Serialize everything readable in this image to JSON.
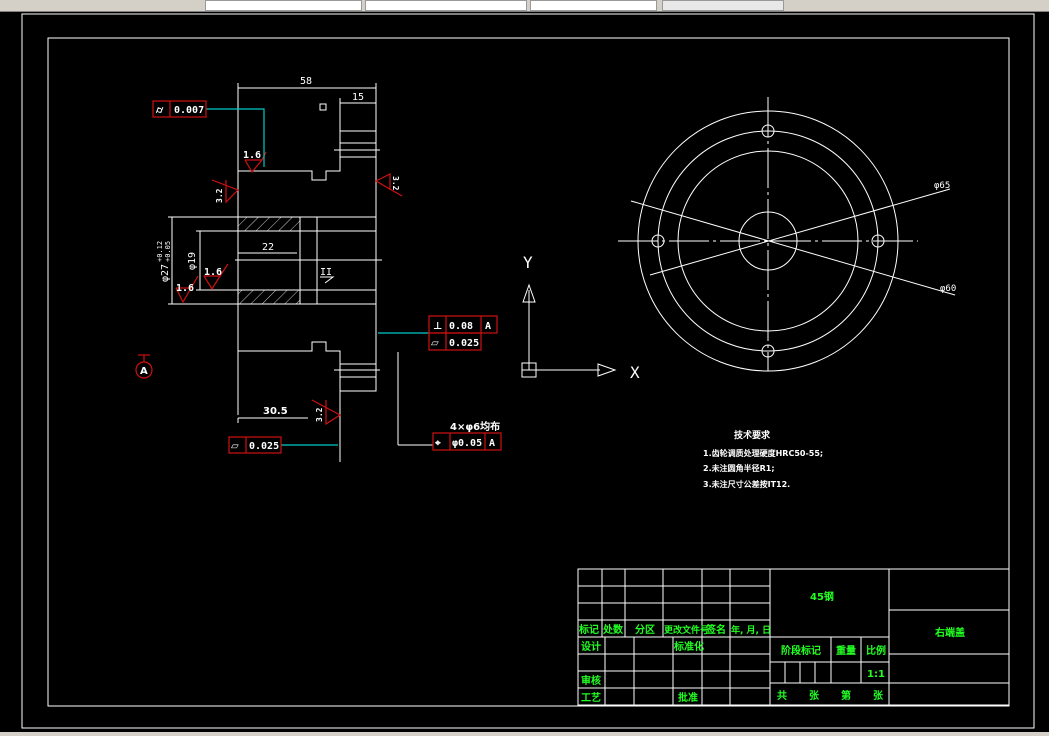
{
  "window": {
    "tabs": [
      "",
      "",
      "",
      ""
    ]
  },
  "colors": {
    "background": "#000000",
    "lines": "#ffffff",
    "tolerance_frame": "#d01010",
    "leader": "#00c8c8",
    "title_text": "#22ff22"
  },
  "section_view": {
    "dims": {
      "overall_length": "58",
      "flange_width": "15",
      "bore_depth": "22",
      "hub_length": "30.5",
      "bore_dia": "φ19",
      "outer_dia": "φ27",
      "outer_dia_tol_upper": "+0.12",
      "outer_dia_tol_lower": "+0.05"
    },
    "roughness": {
      "r1": "1.6",
      "r2": "1.6",
      "r3": "1.6",
      "r4": "3.2",
      "r5": "3.2",
      "r6": "3.2"
    },
    "section_label": "II",
    "datum": "A",
    "tolerances": [
      {
        "symbol": "cylindricity-icon",
        "value": "0.007",
        "datum": ""
      },
      {
        "symbol": "perpendicularity-icon",
        "value": "0.08",
        "datum": "A"
      },
      {
        "symbol": "flatness-icon",
        "value": "0.025",
        "datum": ""
      },
      {
        "symbol": "flatness-icon",
        "value": "0.025",
        "datum": ""
      },
      {
        "symbol": "position-icon",
        "value": "φ0.05",
        "datum": "A"
      }
    ],
    "hole_note": "4×φ6均布"
  },
  "end_view": {
    "dims": {
      "d1": "φ65",
      "d2": "φ60"
    }
  },
  "ucs": {
    "x": "X",
    "y": "Y"
  },
  "tech_requirements": {
    "title": "技术要求",
    "items": [
      "1.齿轮调质处理硬度HRC50-55;",
      "2.未注圆角半径R1;",
      "3.未注尺寸公差按IT12."
    ]
  },
  "title_block": {
    "material": "45钢",
    "part_name": "右端盖",
    "headers": [
      "标记",
      "处数",
      "分区",
      "更改文件号",
      "签名",
      "年, 月, 日"
    ],
    "design": "设计",
    "standardize": "标准化",
    "review": "审核",
    "process": "工艺",
    "approve": "批准",
    "stage_mark": "阶段标记",
    "weight": "重量",
    "scale_label": "比例",
    "scale": "1:1",
    "sheet": [
      "共",
      "张",
      "第",
      "张"
    ]
  }
}
